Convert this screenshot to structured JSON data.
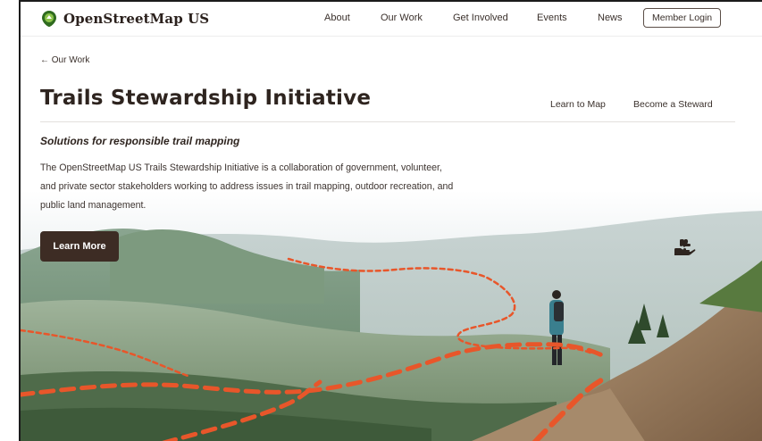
{
  "header": {
    "logo_text": "OpenStreetMap US",
    "nav": [
      "About",
      "Our Work",
      "Get Involved",
      "Events",
      "News"
    ],
    "member_login": "Member Login"
  },
  "breadcrumb": "← Our Work",
  "page_title": "Trails Stewardship Initiative",
  "subnav": [
    "Learn to Map",
    "Become a Steward"
  ],
  "tagline": "Solutions for responsible trail mapping",
  "description": "The OpenStreetMap US Trails Stewardship Initiative is a collaboration of government, volunteer, and private sector stakeholders working to address issues in trail mapping, outdoor recreation, and public land management.",
  "cta_label": "Learn More",
  "icons": [
    "logo-map-pin-icon",
    "slack-icon",
    "hand-heart-icon"
  ],
  "colors": {
    "accent_orange": "#e8562a",
    "button_brown": "#3d2c24",
    "logo_green": "#2f6b1f",
    "text_dark": "#2e241f"
  }
}
